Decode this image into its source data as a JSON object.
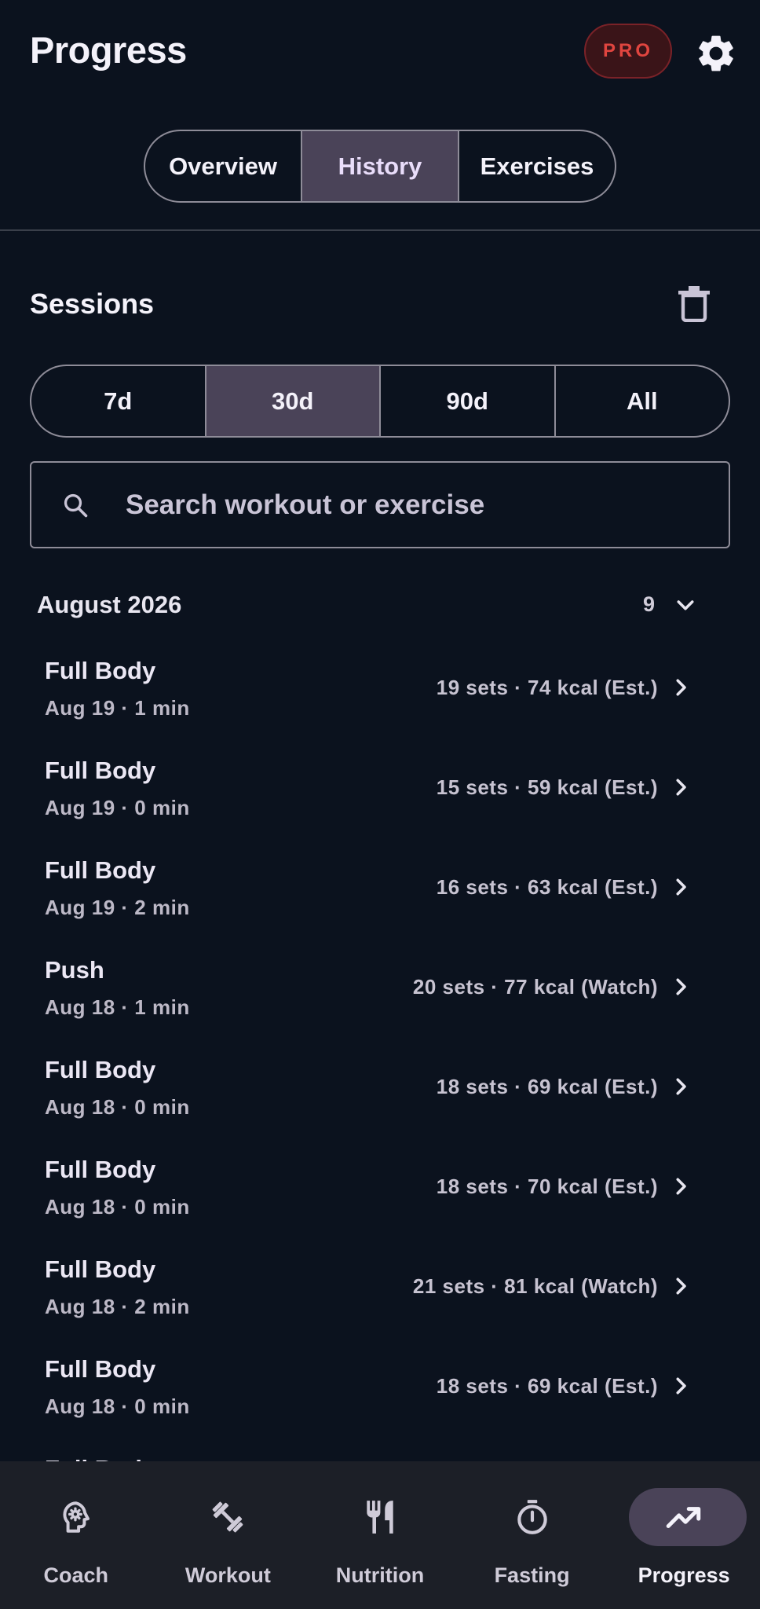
{
  "appbar": {
    "title": "Progress",
    "pro_badge": "PRO",
    "settings_icon": "gear-icon"
  },
  "tabs": [
    {
      "label": "Overview",
      "active": false
    },
    {
      "label": "History",
      "active": true
    },
    {
      "label": "Exercises",
      "active": false
    }
  ],
  "sessions": {
    "title": "Sessions",
    "delete_icon": "trash-icon",
    "ranges": [
      {
        "label": "7d",
        "active": false
      },
      {
        "label": "30d",
        "active": true
      },
      {
        "label": "90d",
        "active": false
      },
      {
        "label": "All",
        "active": false
      }
    ],
    "search_placeholder": "Search workout or exercise",
    "search_value": ""
  },
  "month": {
    "label": "August 2026",
    "count": "9",
    "expanded": true
  },
  "workouts": [
    {
      "title": "Full Body",
      "subtitle": "Aug 19 · 1 min",
      "meta": "19 sets · 74 kcal (Est.)"
    },
    {
      "title": "Full Body",
      "subtitle": "Aug 19 · 0 min",
      "meta": "15 sets · 59 kcal (Est.)"
    },
    {
      "title": "Full Body",
      "subtitle": "Aug 19 · 2 min",
      "meta": "16 sets · 63 kcal (Est.)"
    },
    {
      "title": "Push",
      "subtitle": "Aug 18 · 1 min",
      "meta": "20 sets · 77 kcal (Watch)"
    },
    {
      "title": "Full Body",
      "subtitle": "Aug 18 · 0 min",
      "meta": "18 sets · 69 kcal (Est.)"
    },
    {
      "title": "Full Body",
      "subtitle": "Aug 18 · 0 min",
      "meta": "18 sets · 70 kcal (Est.)"
    },
    {
      "title": "Full Body",
      "subtitle": "Aug 18 · 2 min",
      "meta": "21 sets · 81 kcal (Watch)"
    },
    {
      "title": "Full Body",
      "subtitle": "Aug 18 · 0 min",
      "meta": "18 sets · 69 kcal (Est.)"
    },
    {
      "title": "Full Body",
      "subtitle": "",
      "meta": ""
    }
  ],
  "bottom_nav": [
    {
      "label": "Coach",
      "icon": "brain-icon",
      "active": false
    },
    {
      "label": "Workout",
      "icon": "dumbbell-icon",
      "active": false
    },
    {
      "label": "Nutrition",
      "icon": "fork-knife-icon",
      "active": false
    },
    {
      "label": "Fasting",
      "icon": "timer-icon",
      "active": false
    },
    {
      "label": "Progress",
      "icon": "trending-up-icon",
      "active": true
    }
  ],
  "colors": {
    "background": "#0b121e",
    "active_segment": "#4a4358",
    "pro_text": "#e0453f",
    "nav_background": "#1c1f27"
  }
}
